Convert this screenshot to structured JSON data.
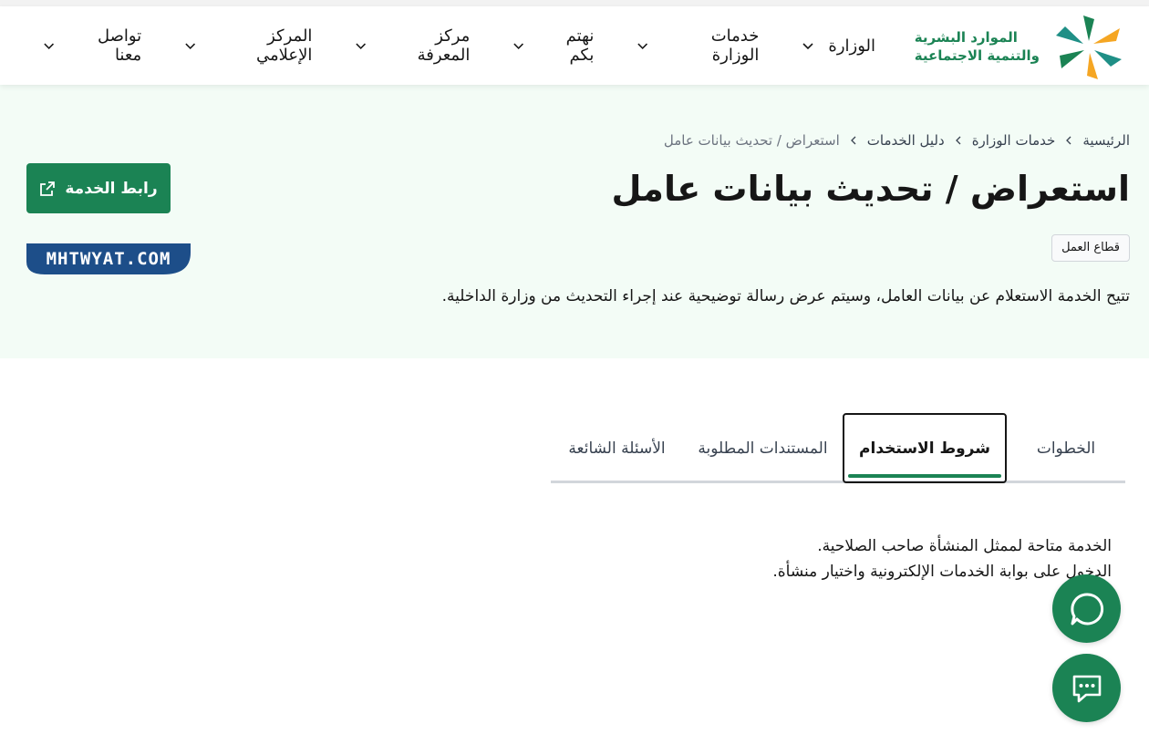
{
  "header": {
    "logo": {
      "line1": "الموارد البشرية",
      "line2": "والتنمية الاجتماعية"
    },
    "nav": [
      {
        "label": "الوزارة"
      },
      {
        "label": "خدمات الوزارة"
      },
      {
        "label": "نهتم بكم"
      },
      {
        "label": "مركز المعرفة"
      },
      {
        "label": "المركز الإعلامي"
      },
      {
        "label": "تواصل معنا"
      }
    ]
  },
  "breadcrumb": [
    "الرئيسية",
    "خدمات الوزارة",
    "دليل الخدمات",
    "استعراض / تحديث بيانات عامل"
  ],
  "page": {
    "title": "استعراض / تحديث بيانات عامل",
    "sector": "قطاع العمل",
    "description": "تتيح الخدمة الاستعلام عن بيانات العامل، وسيتم عرض رسالة توضيحية عند إجراء التحديث من وزارة الداخلية.",
    "service_button": "رابط الخدمة",
    "watermark": "MHTWYAT.COM"
  },
  "tabs": [
    {
      "label": "الخطوات"
    },
    {
      "label": "شروط الاستخدام",
      "active": true
    },
    {
      "label": "المستندات المطلوبة"
    },
    {
      "label": "الأسئلة الشائعة"
    }
  ],
  "content": {
    "lines": [
      "الخدمة متاحة لممثل المنشأة صاحب الصلاحية.",
      "الدخول على بوابة الخدمات الإلكترونية واختيار منشأة."
    ]
  },
  "fabs": [
    {
      "icon": "whatsapp-icon"
    },
    {
      "icon": "chat-icon"
    }
  ],
  "colors": {
    "primary": "#1b8354",
    "hero_bg": "#f3fcf6",
    "watermark_bg": "#1d4e89"
  }
}
